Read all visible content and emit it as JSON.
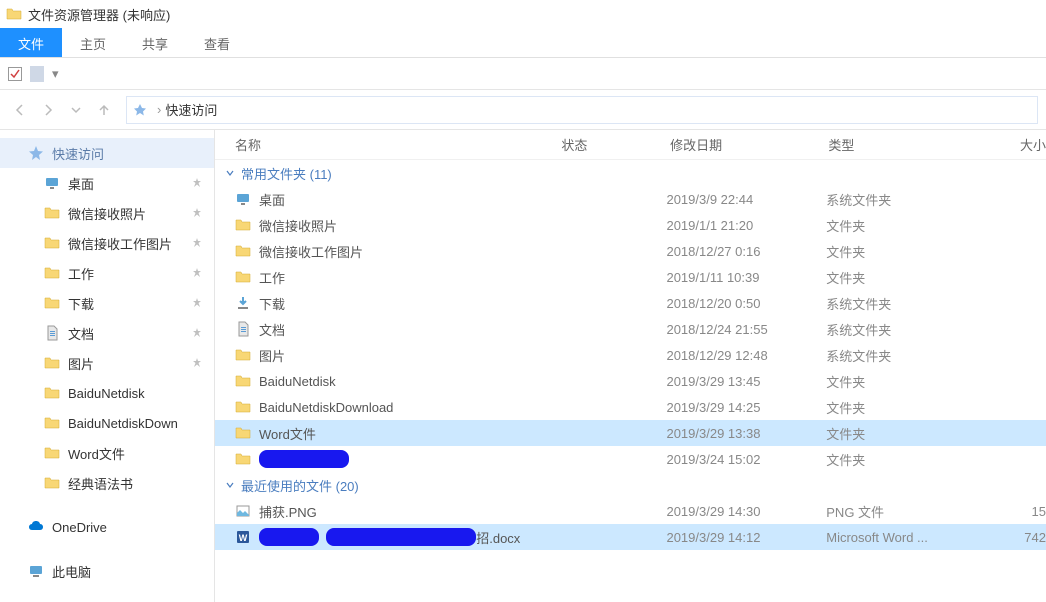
{
  "titlebar": {
    "text": "文件资源管理器 (未响应)"
  },
  "ribbon": {
    "tabs": [
      {
        "label": "文件",
        "active": true
      },
      {
        "label": "主页",
        "active": false
      },
      {
        "label": "共享",
        "active": false
      },
      {
        "label": "查看",
        "active": false
      }
    ]
  },
  "address": {
    "location": "快速访问",
    "sep": "›"
  },
  "sidebar": {
    "quickaccess": "快速访问",
    "items": [
      {
        "label": "桌面",
        "icon": "desktop",
        "pinned": true
      },
      {
        "label": "微信接收照片",
        "icon": "folder",
        "pinned": true
      },
      {
        "label": "微信接收工作图片",
        "icon": "folder",
        "pinned": true
      },
      {
        "label": "工作",
        "icon": "folder",
        "pinned": true
      },
      {
        "label": "下载",
        "icon": "folder",
        "pinned": true
      },
      {
        "label": "文档",
        "icon": "document",
        "pinned": true
      },
      {
        "label": "图片",
        "icon": "folder",
        "pinned": true
      },
      {
        "label": "BaiduNetdisk",
        "icon": "folder",
        "pinned": false
      },
      {
        "label": "BaiduNetdiskDown",
        "icon": "folder",
        "pinned": false
      },
      {
        "label": "Word文件",
        "icon": "folder",
        "pinned": false
      },
      {
        "label": "经典语法书",
        "icon": "folder",
        "pinned": false
      }
    ],
    "onedrive": "OneDrive",
    "thispc": "此电脑"
  },
  "columns": {
    "name": "名称",
    "status": "状态",
    "date": "修改日期",
    "type": "类型",
    "size": "大小"
  },
  "groups": [
    {
      "title": "常用文件夹 (11)",
      "rows": [
        {
          "name": "桌面",
          "icon": "desktop",
          "date": "2019/3/9 22:44",
          "type": "系统文件夹",
          "size": ""
        },
        {
          "name": "微信接收照片",
          "icon": "folder",
          "date": "2019/1/1 21:20",
          "type": "文件夹",
          "size": ""
        },
        {
          "name": "微信接收工作图片",
          "icon": "folder",
          "date": "2018/12/27 0:16",
          "type": "文件夹",
          "size": ""
        },
        {
          "name": "工作",
          "icon": "folder",
          "date": "2019/1/11 10:39",
          "type": "文件夹",
          "size": ""
        },
        {
          "name": "下载",
          "icon": "downloads",
          "date": "2018/12/20 0:50",
          "type": "系统文件夹",
          "size": ""
        },
        {
          "name": "文档",
          "icon": "document",
          "date": "2018/12/24 21:55",
          "type": "系统文件夹",
          "size": ""
        },
        {
          "name": "图片",
          "icon": "folder",
          "date": "2018/12/29 12:48",
          "type": "系统文件夹",
          "size": ""
        },
        {
          "name": "BaiduNetdisk",
          "icon": "folder",
          "date": "2019/3/29 13:45",
          "type": "文件夹",
          "size": ""
        },
        {
          "name": "BaiduNetdiskDownload",
          "icon": "folder",
          "date": "2019/3/29 14:25",
          "type": "文件夹",
          "size": ""
        },
        {
          "name": "Word文件",
          "icon": "folder",
          "date": "2019/3/29 13:38",
          "type": "文件夹",
          "size": "",
          "selected": true
        },
        {
          "name": "",
          "icon": "folder",
          "date": "2019/3/24 15:02",
          "type": "文件夹",
          "size": "",
          "redacted": true
        }
      ]
    },
    {
      "title": "最近使用的文件 (20)",
      "rows": [
        {
          "name": "捕获.PNG",
          "icon": "image",
          "date": "2019/3/29 14:30",
          "type": "PNG 文件",
          "size": "15"
        },
        {
          "name": "招.docx",
          "icon": "word",
          "date": "2019/3/29 14:12",
          "type": "Microsoft Word ...",
          "size": "742",
          "selected": true,
          "redacted": true
        }
      ]
    }
  ]
}
